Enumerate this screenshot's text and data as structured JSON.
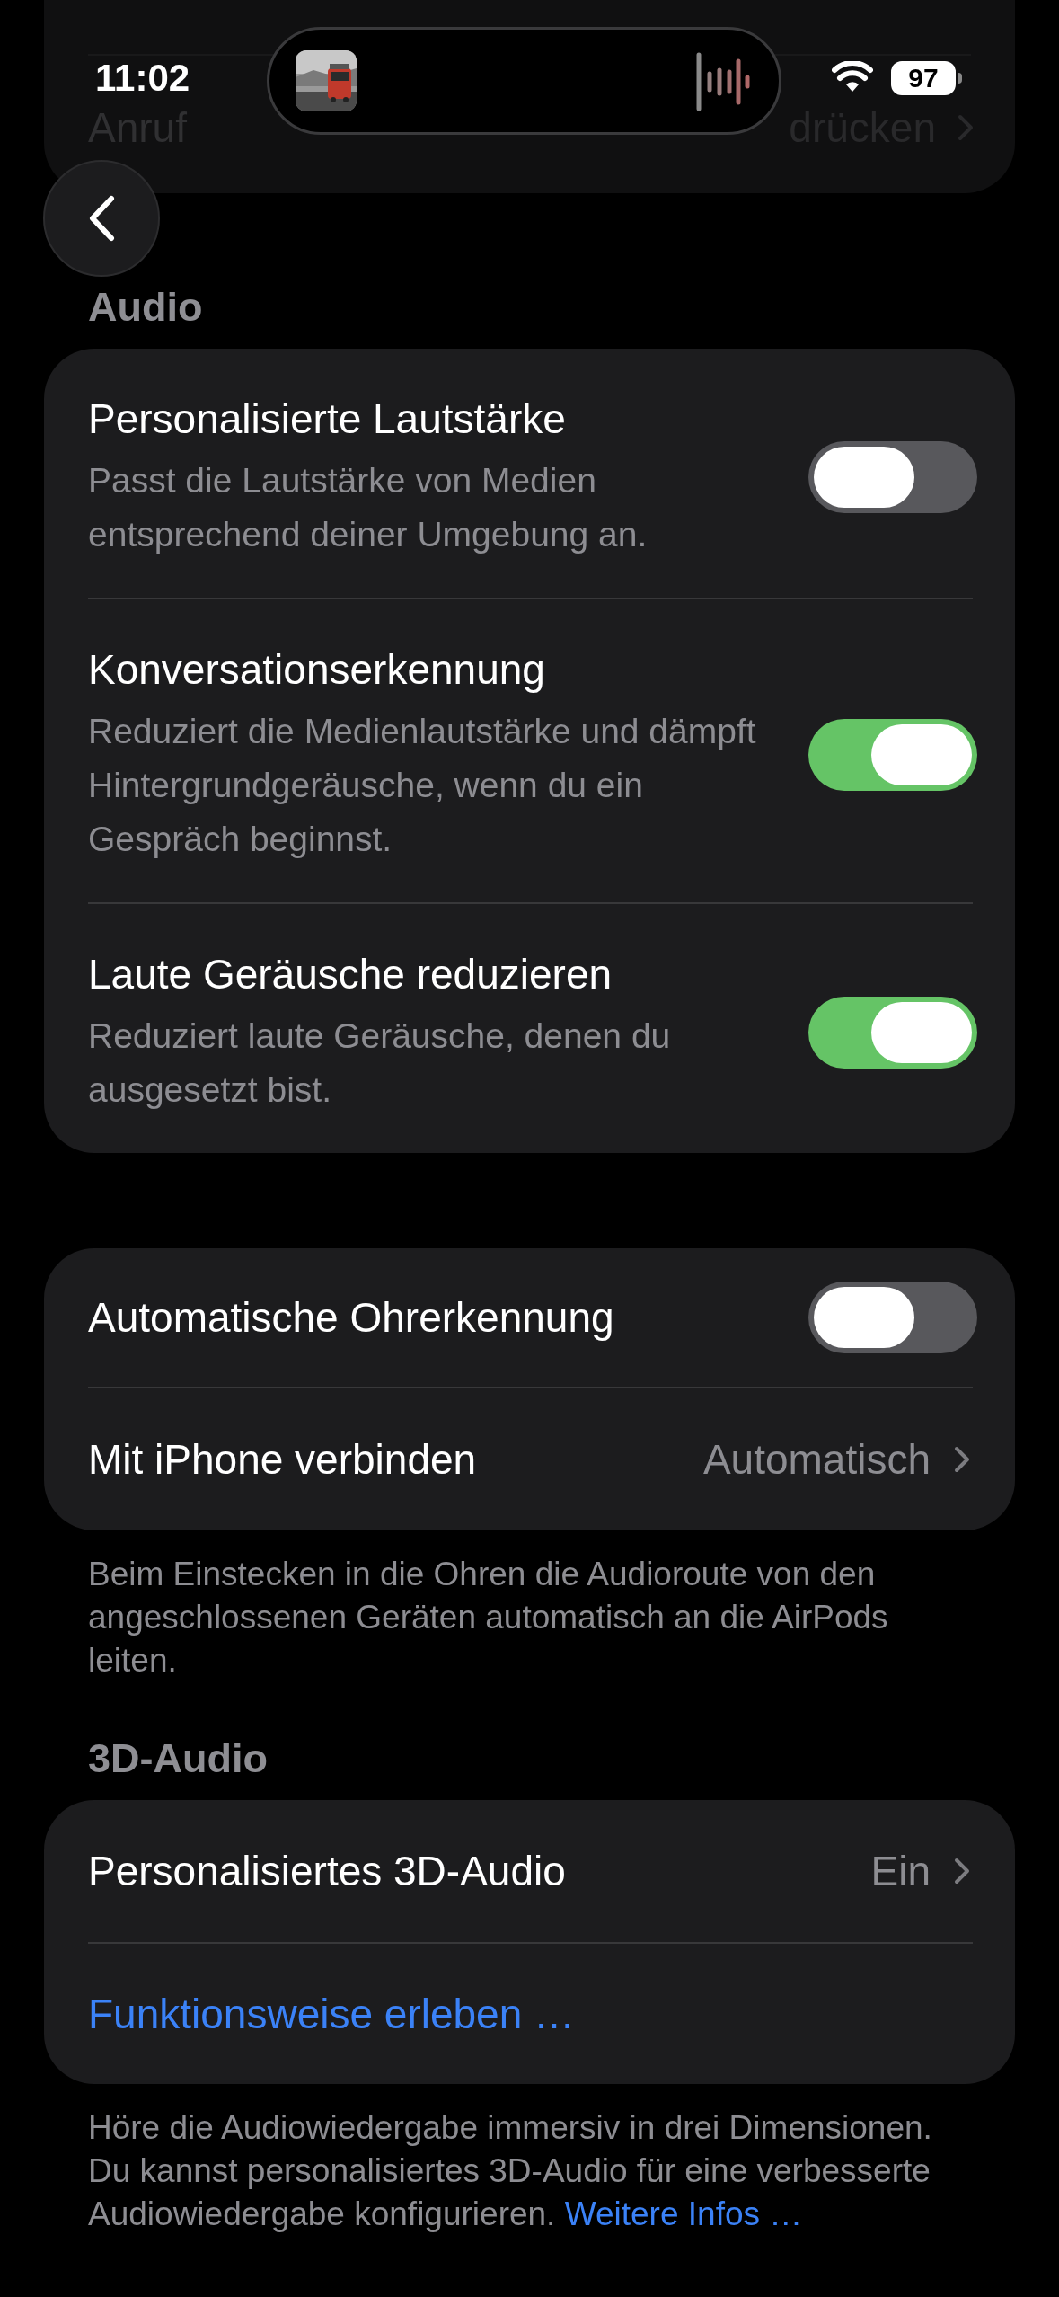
{
  "status_bar": {
    "time": "11:02",
    "battery": "97"
  },
  "previous_row": {
    "label": "Anruf",
    "value": "drücken"
  },
  "sections": [
    {
      "header": "Audio",
      "rows": [
        {
          "kind": "toggle",
          "title": "Personalisierte Lautstärke",
          "subtitle": "Passt die Lautstärke von Medien entsprechend deiner Umgebung an.",
          "on": false
        },
        {
          "kind": "toggle",
          "title": "Konversationserkennung",
          "subtitle": "Reduziert die Medienlautstärke und dämpft Hintergrundgeräusche, wenn du ein Gespräch beginnst.",
          "on": true
        },
        {
          "kind": "toggle",
          "title": "Laute Geräusche reduzieren",
          "subtitle": "Reduziert laute Geräusche, denen du ausgesetzt bist.",
          "on": true
        }
      ]
    },
    {
      "rows": [
        {
          "kind": "toggle",
          "title": "Automatische Ohrerkennung",
          "on": false
        },
        {
          "kind": "value",
          "title": "Mit iPhone verbinden",
          "value": "Automatisch"
        }
      ],
      "footer": "Beim Einstecken in die Ohren die Audioroute von den angeschlossenen Geräten automatisch an die AirPods leiten."
    },
    {
      "header": "3D-Audio",
      "rows": [
        {
          "kind": "value",
          "title": "Personalisiertes 3D-Audio",
          "value": "Ein"
        },
        {
          "kind": "link",
          "title": "Funktionsweise erleben …"
        }
      ],
      "footer": "Höre die Audiowiedergabe immersiv in drei Dimensionen. Du kannst personalisiertes 3D-Audio für eine verbesserte Audiowiedergabe konfigurieren.",
      "footer_link": "Weitere Infos …"
    }
  ]
}
